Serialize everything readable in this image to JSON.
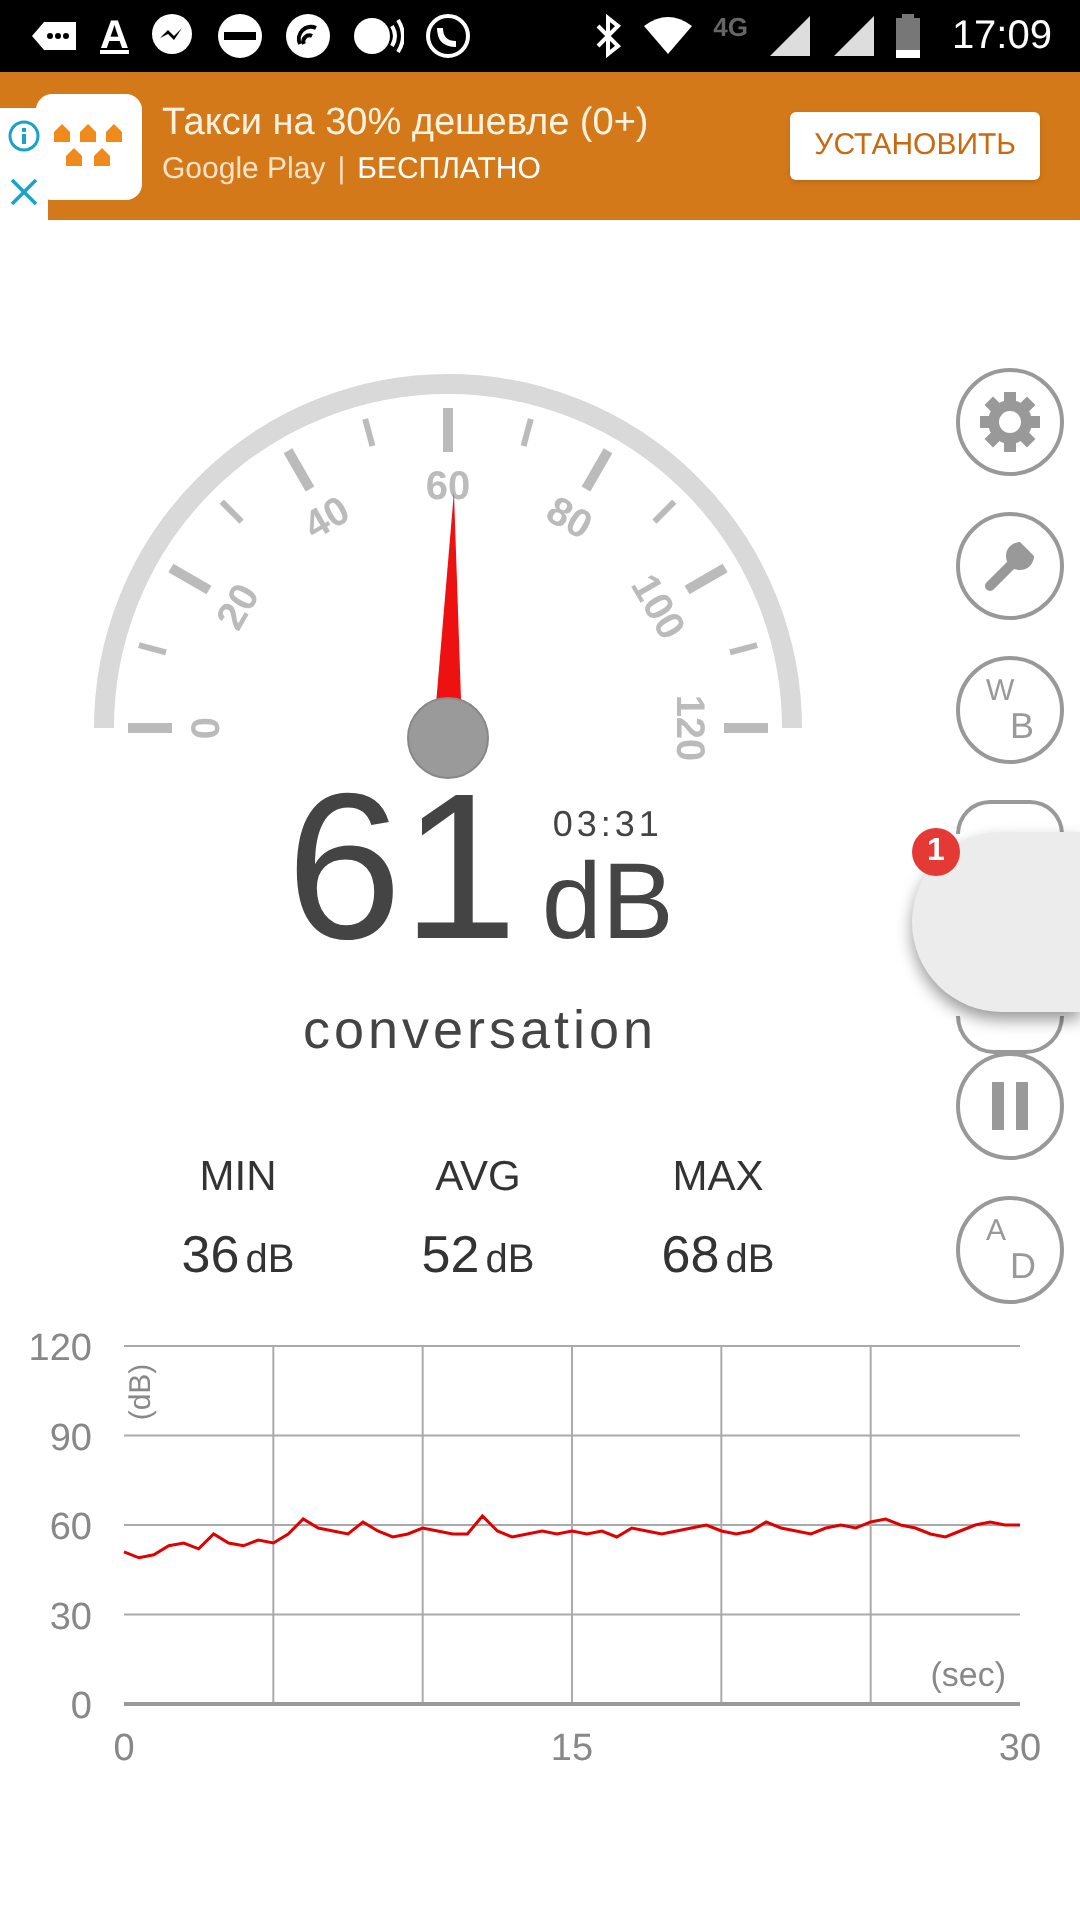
{
  "status_bar": {
    "app_letter": "A",
    "network": "4G",
    "time": "17:09"
  },
  "ad": {
    "title": "Такси на 30% дешевле (0+)",
    "store": "Google Play",
    "separator": "|",
    "price": "БЕСПЛАТНО",
    "button": "УСТАНОВИТЬ"
  },
  "gauge": {
    "scale_labels": [
      "0",
      "20",
      "40",
      "60",
      "80",
      "100",
      "120"
    ]
  },
  "reading": {
    "value": "61",
    "unit": "dB",
    "timer": "03:31",
    "description": "conversation"
  },
  "stats": [
    {
      "label": "MIN",
      "value": "36",
      "unit": "dB"
    },
    {
      "label": "AVG",
      "value": "52",
      "unit": "dB"
    },
    {
      "label": "MAX",
      "value": "68",
      "unit": "dB"
    }
  ],
  "side_buttons": [
    {
      "kind": "settings"
    },
    {
      "kind": "tools"
    },
    {
      "kind": "letters",
      "top": "W",
      "bottom": "B"
    },
    {
      "kind": "covered_top"
    },
    {
      "kind": "covered_bottom"
    },
    {
      "kind": "pause"
    },
    {
      "kind": "letters",
      "top": "A",
      "bottom": "D"
    }
  ],
  "chat_head": {
    "badge": "1"
  },
  "chart_data": {
    "type": "line",
    "xlabel": "(sec)",
    "ylabel": "(dB)",
    "grid": true,
    "xlim": [
      0,
      30
    ],
    "ylim": [
      0,
      120
    ],
    "xticks": [
      0,
      15,
      30
    ],
    "yticks": [
      0,
      30,
      60,
      90,
      120
    ],
    "x": [
      0,
      0.5,
      1,
      1.5,
      2,
      2.5,
      3,
      3.5,
      4,
      4.5,
      5,
      5.5,
      6,
      6.5,
      7,
      7.5,
      8,
      8.5,
      9,
      9.5,
      10,
      10.5,
      11,
      11.5,
      12,
      12.5,
      13,
      13.5,
      14,
      14.5,
      15,
      15.5,
      16,
      16.5,
      17,
      17.5,
      18,
      18.5,
      19,
      19.5,
      20,
      20.5,
      21,
      21.5,
      22,
      22.5,
      23,
      23.5,
      24,
      24.5,
      25,
      25.5,
      26,
      26.5,
      27,
      27.5,
      28,
      28.5,
      29,
      29.5,
      30
    ],
    "series": [
      {
        "color": "#e00000",
        "values": [
          51,
          49,
          50,
          53,
          54,
          52,
          57,
          54,
          53,
          55,
          54,
          57,
          62,
          59,
          58,
          57,
          61,
          58,
          56,
          57,
          59,
          58,
          57,
          57,
          63,
          58,
          56,
          57,
          58,
          57,
          58,
          57,
          58,
          56,
          59,
          58,
          57,
          58,
          59,
          60,
          58,
          57,
          58,
          61,
          59,
          58,
          57,
          59,
          60,
          59,
          61,
          62,
          60,
          59,
          57,
          56,
          58,
          60,
          61,
          60,
          60
        ]
      }
    ]
  }
}
